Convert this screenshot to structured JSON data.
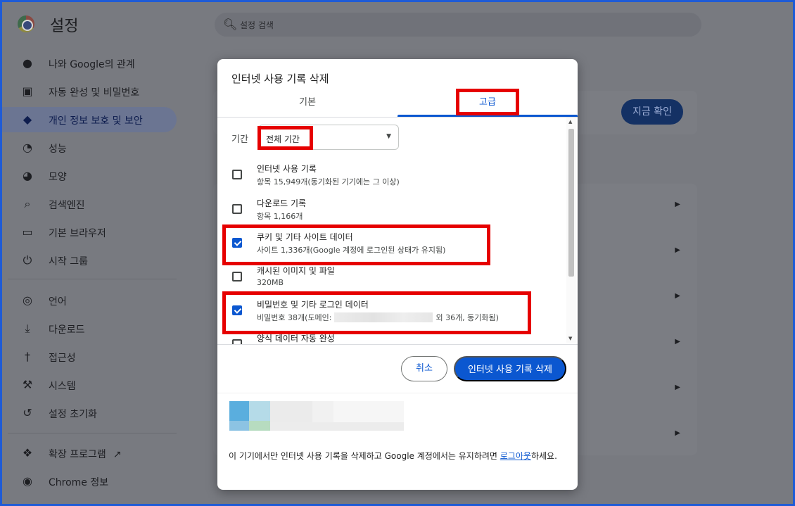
{
  "app": {
    "title": "설정"
  },
  "search": {
    "placeholder": "설정 검색"
  },
  "sidebar": {
    "items": [
      {
        "label": "나와 Google의 관계",
        "icon": "person-icon"
      },
      {
        "label": "자동 완성 및 비밀번호",
        "icon": "clipboard-icon"
      },
      {
        "label": "개인 정보 보호 및 보안",
        "icon": "shield-icon",
        "active": true
      },
      {
        "label": "성능",
        "icon": "gauge-icon"
      },
      {
        "label": "모양",
        "icon": "palette-icon"
      },
      {
        "label": "검색엔진",
        "icon": "search-icon"
      },
      {
        "label": "기본 브라우저",
        "icon": "browser-icon"
      },
      {
        "label": "시작 그룹",
        "icon": "power-icon"
      },
      {
        "label": "언어",
        "icon": "globe-icon"
      },
      {
        "label": "다운로드",
        "icon": "download-icon"
      },
      {
        "label": "접근성",
        "icon": "accessibility-icon"
      },
      {
        "label": "시스템",
        "icon": "wrench-icon"
      },
      {
        "label": "설정 초기화",
        "icon": "reset-icon"
      },
      {
        "label": "확장 프로그램",
        "icon": "puzzle-icon"
      },
      {
        "label": "Chrome 정보",
        "icon": "chrome-icon"
      }
    ]
  },
  "main": {
    "check_now_label": "지금 확인"
  },
  "dialog": {
    "title": "인터넷 사용 기록 삭제",
    "tabs": {
      "basic": "기본",
      "advanced": "고급"
    },
    "range_label": "기간",
    "range_value": "전체 기간",
    "items": [
      {
        "title": "인터넷 사용 기록",
        "desc": "항목 15,949개(동기화된 기기에는 그 이상)",
        "checked": false
      },
      {
        "title": "다운로드 기록",
        "desc": "항목 1,166개",
        "checked": false
      },
      {
        "title": "쿠키 및 기타 사이트 데이터",
        "desc": "사이트 1,336개(Google 계정에 로그인된 상태가 유지됨)",
        "checked": true
      },
      {
        "title": "캐시된 이미지 및 파일",
        "desc": "320MB",
        "checked": false
      },
      {
        "title": "비밀번호 및 기타 로그인 데이터",
        "desc_prefix": "비밀번호 38개(도메인:",
        "desc_suffix": "외 36개, 동기화됨)",
        "checked": true
      },
      {
        "title": "양식 데이터 자동 완성",
        "checked": false
      }
    ],
    "cancel_label": "취소",
    "delete_label": "인터넷 사용 기록 삭제",
    "footer_text": "이 기기에서만 인터넷 사용 기록을 삭제하고 Google 계정에서는 유지하려면 ",
    "footer_link": "로그아웃",
    "footer_suffix": "하세요."
  },
  "colors": {
    "accent": "#0b57d0",
    "highlight": "#e60000",
    "frame": "#1f5bd6"
  }
}
